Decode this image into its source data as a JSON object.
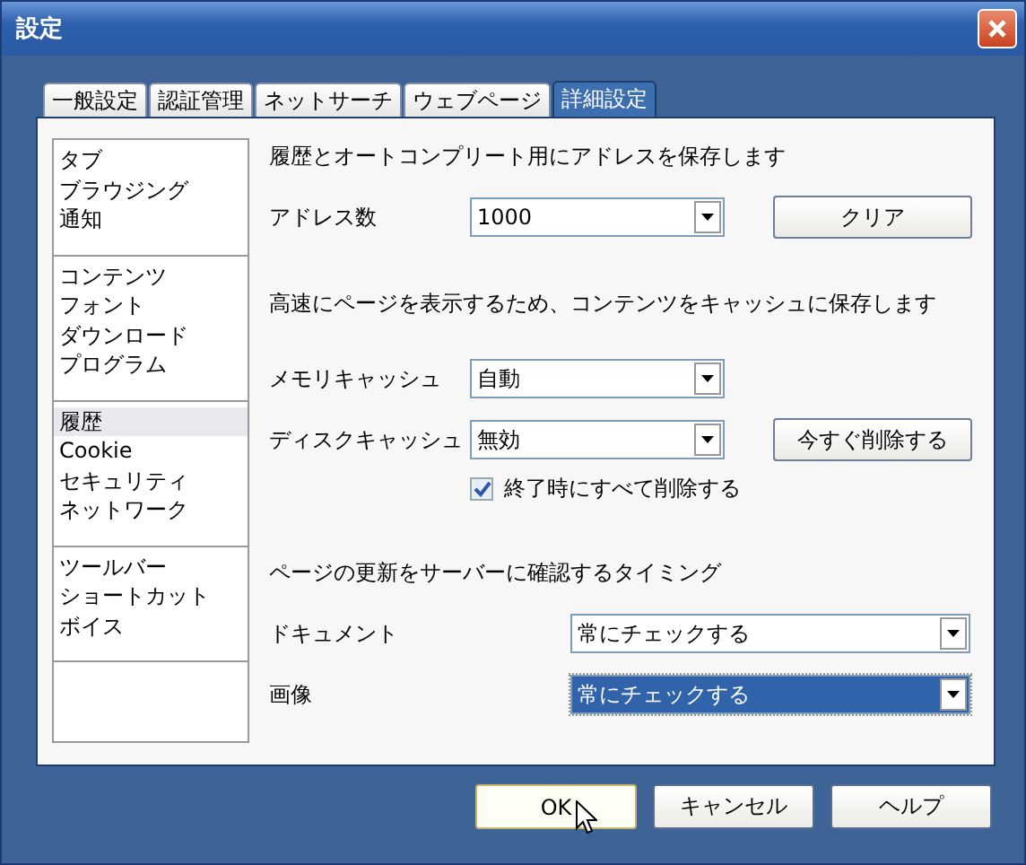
{
  "window": {
    "title": "設定"
  },
  "tabs": [
    {
      "label": "一般設定",
      "selected": false
    },
    {
      "label": "認証管理",
      "selected": false
    },
    {
      "label": "ネットサーチ",
      "selected": false
    },
    {
      "label": "ウェブページ",
      "selected": false
    },
    {
      "label": "詳細設定",
      "selected": true
    }
  ],
  "sidebar": {
    "groups": [
      {
        "items": [
          {
            "label": "タブ",
            "selected": false
          },
          {
            "label": "ブラウジング",
            "selected": false
          },
          {
            "label": "通知",
            "selected": false
          }
        ]
      },
      {
        "items": [
          {
            "label": "コンテンツ",
            "selected": false
          },
          {
            "label": "フォント",
            "selected": false
          },
          {
            "label": "ダウンロード",
            "selected": false
          },
          {
            "label": "プログラム",
            "selected": false
          }
        ]
      },
      {
        "items": [
          {
            "label": "履歴",
            "selected": true
          },
          {
            "label": "Cookie",
            "selected": false
          },
          {
            "label": "セキュリティ",
            "selected": false
          },
          {
            "label": "ネットワーク",
            "selected": false
          }
        ]
      },
      {
        "items": [
          {
            "label": "ツールバー",
            "selected": false
          },
          {
            "label": "ショートカット",
            "selected": false
          },
          {
            "label": "ボイス",
            "selected": false
          }
        ]
      }
    ]
  },
  "sections": [
    {
      "heading": "履歴とオートコンプリート用にアドレスを保存します",
      "rows": [
        {
          "kind": "select",
          "label": "アドレス数",
          "value": "1000",
          "focused": false,
          "button": "クリア"
        }
      ]
    },
    {
      "heading": "高速にページを表示するため、コンテンツをキャッシュに保存します",
      "rows": [
        {
          "kind": "select",
          "label": "メモリキャッシュ",
          "value": "自動",
          "focused": false
        },
        {
          "kind": "select",
          "label": "ディスクキャッシュ",
          "value": "無効",
          "focused": false,
          "button": "今すぐ削除する"
        },
        {
          "kind": "checkbox",
          "label": "終了時にすべて削除する",
          "checked": true
        }
      ]
    },
    {
      "heading": "ページの更新をサーバーに確認するタイミング",
      "rows": [
        {
          "kind": "wide-select",
          "label": "ドキュメント",
          "value": "常にチェックする",
          "focused": false
        },
        {
          "kind": "wide-select",
          "label": "画像",
          "value": "常にチェックする",
          "focused": true
        }
      ]
    }
  ],
  "buttons": [
    {
      "label": "OK",
      "default": true
    },
    {
      "label": "キャンセル",
      "default": false
    },
    {
      "label": "ヘルプ",
      "default": false
    }
  ]
}
